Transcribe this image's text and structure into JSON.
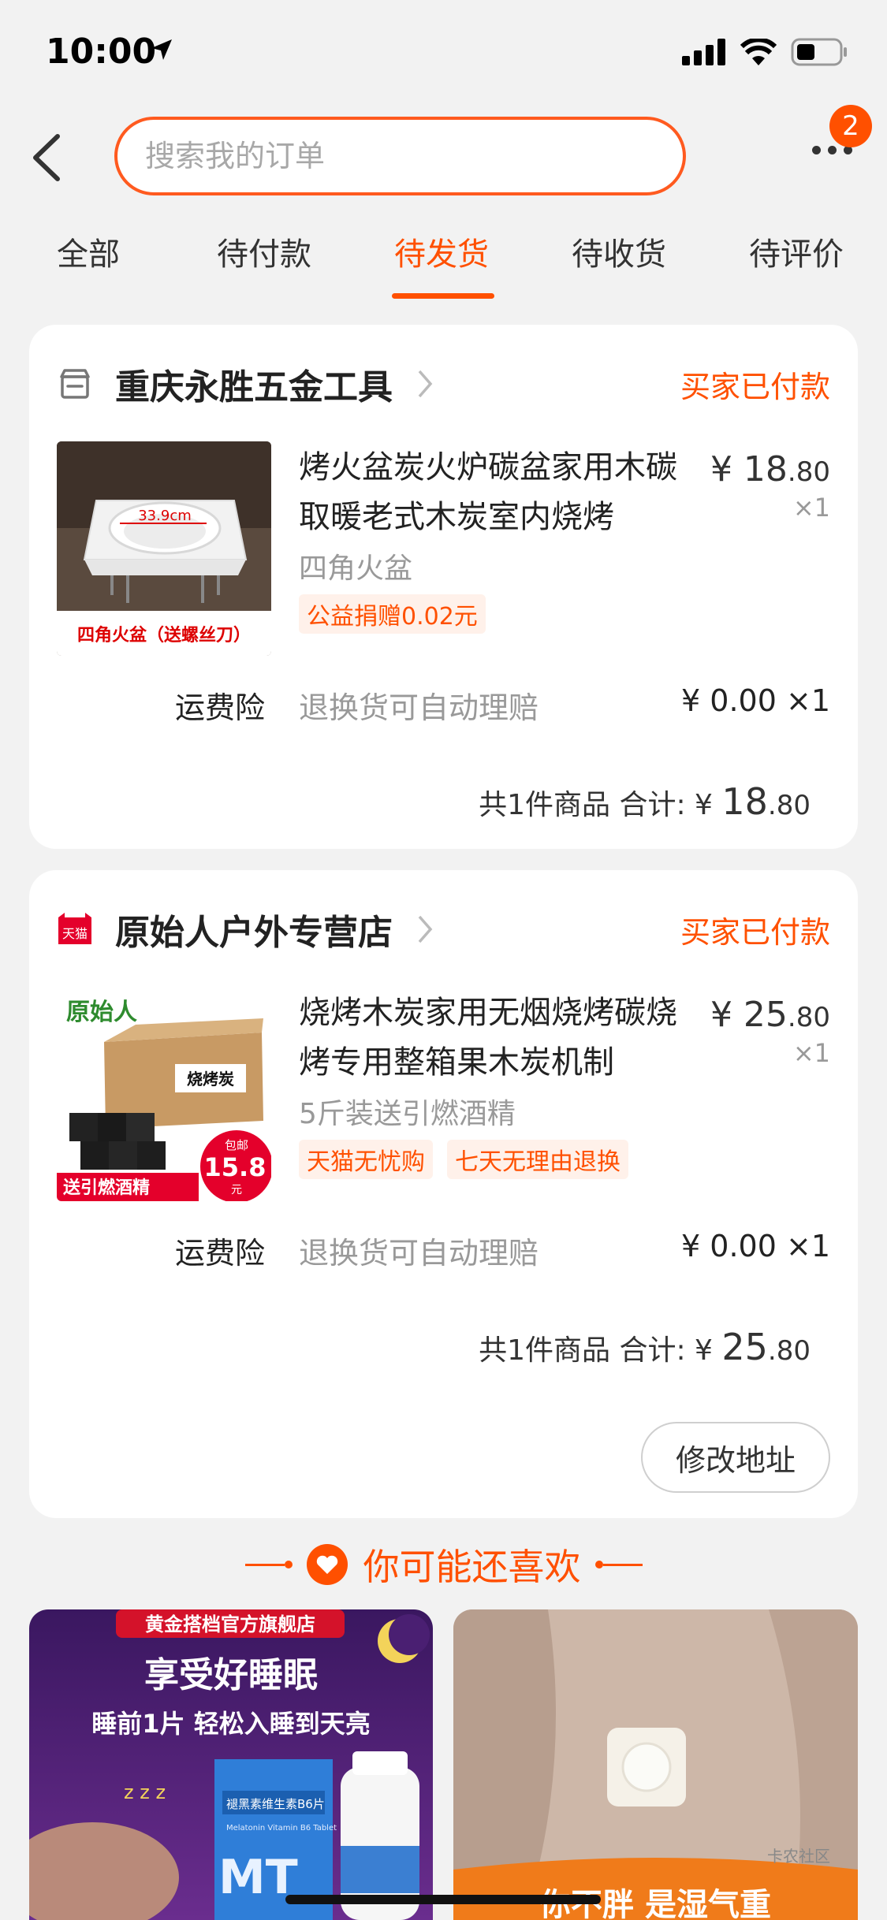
{
  "status_bar": {
    "time": "10:00"
  },
  "header": {
    "search_placeholder": "搜索我的订单",
    "badge_count": "2"
  },
  "tabs": [
    {
      "label": "全部"
    },
    {
      "label": "待付款"
    },
    {
      "label": "待发货",
      "active": true
    },
    {
      "label": "待收货"
    },
    {
      "label": "待评价"
    }
  ],
  "orders": [
    {
      "shop_name": "重庆永胜五金工具",
      "status": "买家已付款",
      "product": {
        "title": "烤火盆炭火炉碳盆家用木碳取暖老式木炭室内烧烤",
        "sku": "四角火盆",
        "tags": [
          "公益捐赠0.02元"
        ],
        "price": "¥ 18.80",
        "price_main": "18",
        "price_decimal": ".80",
        "qty": "×1",
        "image_text": {
          "dimension": "33.9cm",
          "caption": "四角火盆（送螺丝刀）"
        }
      },
      "insurance": {
        "label": "运费险",
        "desc": "退换货可自动理赔",
        "price": "¥ 0.00 ×1"
      },
      "total": {
        "prefix": "共1件商品 合计: ¥ ",
        "main": "18",
        "decimal": ".80"
      }
    },
    {
      "shop_name": "原始人户外专营店",
      "shop_badge": "天猫",
      "status": "买家已付款",
      "product": {
        "title": "烧烤木炭家用无烟烧烤碳烧烤专用整箱果木炭机制",
        "sku": "5斤装送引燃酒精",
        "tags": [
          "天猫无忧购",
          "七天无理由退换"
        ],
        "price": "¥ 25.80",
        "price_main": "25",
        "price_decimal": ".80",
        "qty": "×1",
        "image_text": {
          "brand": "原始人",
          "box": "烧烤炭",
          "promo": "送引燃酒精",
          "ship": "包邮",
          "price": "15.8",
          "unit": "元"
        }
      },
      "insurance": {
        "label": "运费险",
        "desc": "退换货可自动理赔",
        "price": "¥ 0.00 ×1"
      },
      "total": {
        "prefix": "共1件商品 合计: ¥ ",
        "main": "25",
        "decimal": ".80"
      },
      "action": "修改地址"
    }
  ],
  "recommend": {
    "heading": "你可能还喜欢",
    "items": [
      {
        "store": "黄金搭档官方旗舰店",
        "headline": "享受好睡眠",
        "subline": "睡前1片 轻松入睡到天亮",
        "product_name": "褪黑素维生素B6片",
        "product_name_en": "Melatonin Vitamin B6 Tablet",
        "mark": "MT",
        "zz": "z z z"
      },
      {
        "bottom_text": "你不胖 是湿气重",
        "watermark": "卡农社区"
      }
    ]
  },
  "colors": {
    "accent": "#ff5000",
    "page_bg": "#f2f2f2",
    "tmall_red": "#e4002b"
  }
}
